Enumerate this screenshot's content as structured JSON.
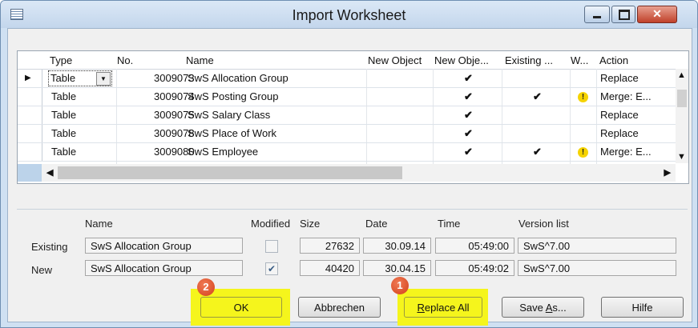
{
  "window": {
    "title": "Import Worksheet"
  },
  "grid": {
    "columns": [
      "Type",
      "No.",
      "Name",
      "New Object",
      "New Obje...",
      "Existing ...",
      "W...",
      "Action"
    ],
    "rows": [
      {
        "type": "Table",
        "no": "3009073",
        "name": "SwS Allocation Group",
        "new_object": "",
        "new_obje": "✔",
        "existing": "",
        "warning": false,
        "action": "Replace"
      },
      {
        "type": "Table",
        "no": "3009074",
        "name": "SwS Posting Group",
        "new_object": "",
        "new_obje": "✔",
        "existing": "✔",
        "warning": true,
        "action": "Merge: E..."
      },
      {
        "type": "Table",
        "no": "3009075",
        "name": "SwS Salary Class",
        "new_object": "",
        "new_obje": "✔",
        "existing": "",
        "warning": false,
        "action": "Replace"
      },
      {
        "type": "Table",
        "no": "3009078",
        "name": "SwS Place of Work",
        "new_object": "",
        "new_obje": "✔",
        "existing": "",
        "warning": false,
        "action": "Replace"
      },
      {
        "type": "Table",
        "no": "3009080",
        "name": "SwS Employee",
        "new_object": "",
        "new_obje": "✔",
        "existing": "✔",
        "warning": true,
        "action": "Merge: E..."
      }
    ],
    "warning_glyph": "!"
  },
  "details": {
    "headers": {
      "name": "Name",
      "modified": "Modified",
      "size": "Size",
      "date": "Date",
      "time": "Time",
      "version": "Version list"
    },
    "existing": {
      "label": "Existing",
      "name": "SwS Allocation Group",
      "modified": false,
      "size": "27632",
      "date": "30.09.14",
      "time": "05:49:00",
      "version": "SwS^7.00"
    },
    "new": {
      "label": "New",
      "name": "SwS Allocation Group",
      "modified": true,
      "size": "40420",
      "date": "30.04.15",
      "time": "05:49:02",
      "version": "SwS^7.00"
    }
  },
  "buttons": {
    "ok": "OK",
    "cancel": "Abbrechen",
    "replace_all_prefix": "R",
    "replace_all_rest": "eplace All",
    "save_as_prefix": "Save ",
    "save_as_u": "A",
    "save_as_rest": "s...",
    "help": "Hilfe"
  },
  "annotations": {
    "badge_ok": "2",
    "badge_replace": "1"
  },
  "colors": {
    "highlight": "#f5f51c",
    "badge": "#d4411b",
    "warning": "#f5d300"
  }
}
